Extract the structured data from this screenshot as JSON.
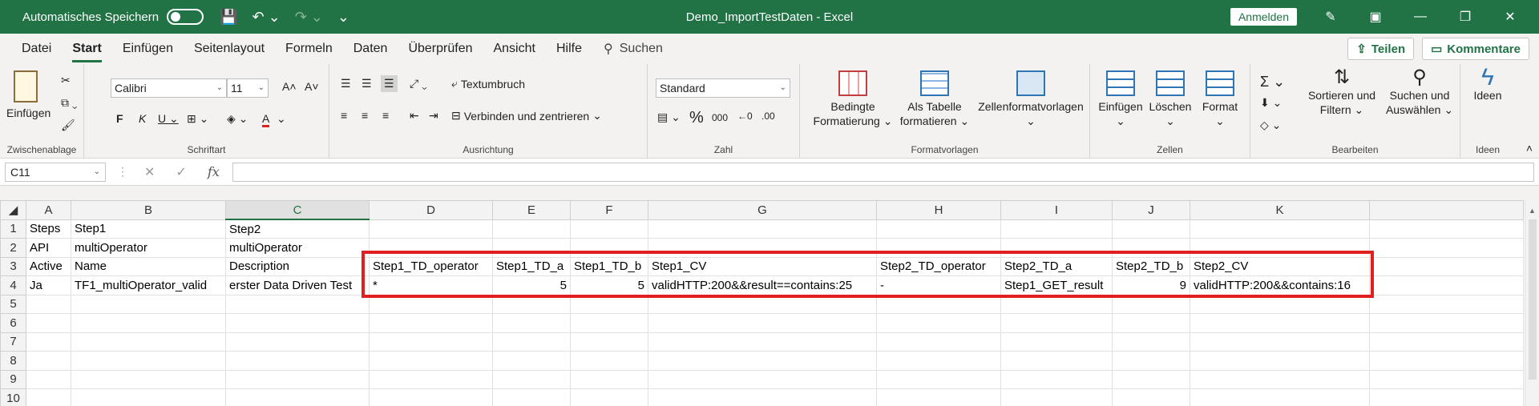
{
  "titlebar": {
    "autosave_label": "Automatisches Speichern",
    "doc_title": "Demo_ImportTestDaten  -  Excel",
    "signin_label": "Anmelden"
  },
  "menu": {
    "tabs": [
      "Datei",
      "Start",
      "Einfügen",
      "Seitenlayout",
      "Formeln",
      "Daten",
      "Überprüfen",
      "Ansicht",
      "Hilfe"
    ],
    "search_label": "Suchen",
    "share_label": "Teilen",
    "comments_label": "Kommentare"
  },
  "ribbon": {
    "clipboard": {
      "paste_label": "Einfügen",
      "group_label": "Zwischenablage"
    },
    "font": {
      "font_name": "Calibri",
      "font_size": "11",
      "group_label": "Schriftart"
    },
    "alignment": {
      "wrap_label": "Textumbruch",
      "merge_label": "Verbinden und zentrieren",
      "group_label": "Ausrichtung"
    },
    "number": {
      "format_value": "Standard",
      "percent_label": "%",
      "thousands_label": "000",
      "group_label": "Zahl"
    },
    "styles": {
      "conditional_label_1": "Bedingte",
      "conditional_label_2": "Formatierung",
      "table_label_1": "Als Tabelle",
      "table_label_2": "formatieren",
      "cellstyles_label": "Zellenformatvorlagen",
      "group_label": "Formatvorlagen"
    },
    "cells": {
      "insert_label": "Einfügen",
      "delete_label": "Löschen",
      "format_label": "Format",
      "group_label": "Zellen"
    },
    "editing": {
      "sort_label_1": "Sortieren und",
      "sort_label_2": "Filtern",
      "find_label_1": "Suchen und",
      "find_label_2": "Auswählen",
      "group_label": "Bearbeiten"
    },
    "ideas": {
      "ideas_label": "Ideen",
      "group_label": "Ideen"
    }
  },
  "formula_bar": {
    "name_box": "C11",
    "fx_label": "fx",
    "formula": ""
  },
  "sheet": {
    "columns": [
      "A",
      "B",
      "C",
      "D",
      "E",
      "F",
      "G",
      "H",
      "I",
      "J",
      "K"
    ],
    "selected_column": "C",
    "rows": [
      {
        "num": "1",
        "cells": [
          "Steps",
          "Step1",
          "Step2",
          "",
          "",
          "",
          "",
          "",
          "",
          "",
          ""
        ]
      },
      {
        "num": "2",
        "cells": [
          "API",
          "multiOperator",
          "multiOperator",
          "",
          "",
          "",
          "",
          "",
          "",
          "",
          ""
        ]
      },
      {
        "num": "3",
        "cells": [
          "Active",
          "Name",
          "Description",
          "Step1_TD_operator",
          "Step1_TD_a",
          "Step1_TD_b",
          "Step1_CV",
          "Step2_TD_operator",
          "Step2_TD_a",
          "Step2_TD_b",
          "Step2_CV"
        ]
      },
      {
        "num": "4",
        "cells": [
          "Ja",
          "TF1_multiOperator_valid",
          "erster Data Driven Test",
          "*",
          "5",
          "5",
          "validHTTP:200&&result==contains:25",
          "-",
          "Step1_GET_result",
          "9",
          "validHTTP:200&&contains:16"
        ]
      },
      {
        "num": "5",
        "cells": [
          "",
          "",
          "",
          "",
          "",
          "",
          "",
          "",
          "",
          "",
          ""
        ]
      },
      {
        "num": "6",
        "cells": [
          "",
          "",
          "",
          "",
          "",
          "",
          "",
          "",
          "",
          "",
          ""
        ]
      },
      {
        "num": "7",
        "cells": [
          "",
          "",
          "",
          "",
          "",
          "",
          "",
          "",
          "",
          "",
          ""
        ]
      },
      {
        "num": "8",
        "cells": [
          "",
          "",
          "",
          "",
          "",
          "",
          "",
          "",
          "",
          "",
          ""
        ]
      },
      {
        "num": "9",
        "cells": [
          "",
          "",
          "",
          "",
          "",
          "",
          "",
          "",
          "",
          "",
          ""
        ]
      },
      {
        "num": "10",
        "cells": [
          "",
          "",
          "",
          "",
          "",
          "",
          "",
          "",
          "",
          "",
          ""
        ]
      }
    ]
  },
  "colors": {
    "accent": "#217346",
    "highlight": "#e02020"
  }
}
